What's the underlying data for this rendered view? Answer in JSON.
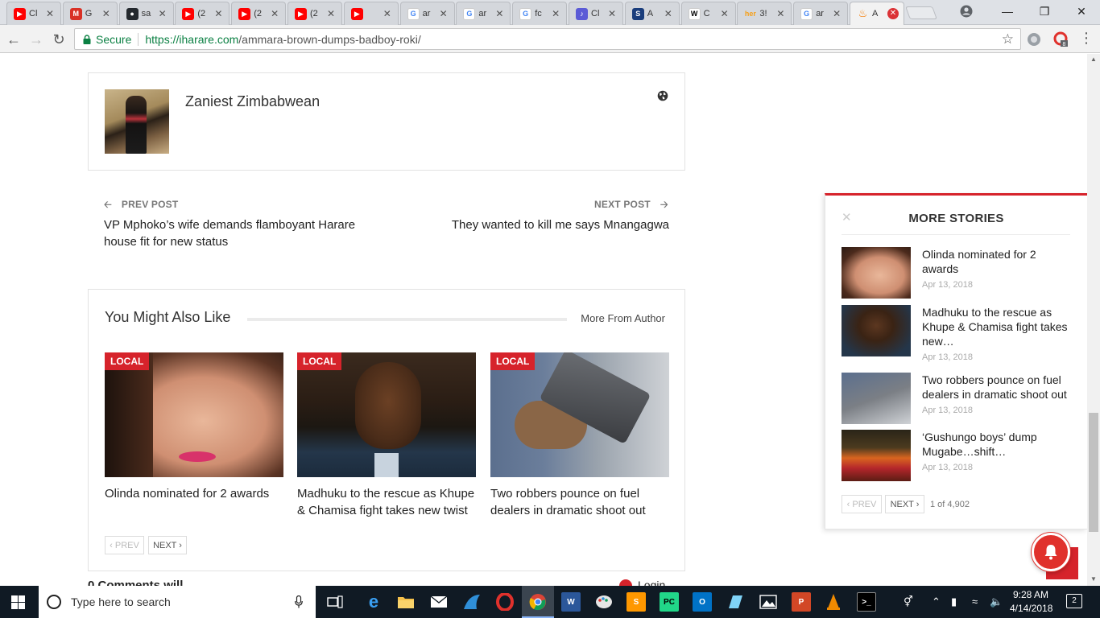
{
  "tabs": [
    {
      "label": "Cl",
      "favicon": "youtube-icon",
      "color": "#ff0000"
    },
    {
      "label": "G",
      "favicon": "gmail-icon",
      "color": "#d93025"
    },
    {
      "label": "sa",
      "favicon": "github-icon",
      "color": "#24292e"
    },
    {
      "label": "(2",
      "favicon": "youtube-icon",
      "color": "#ff0000"
    },
    {
      "label": "(2",
      "favicon": "youtube-icon",
      "color": "#ff0000"
    },
    {
      "label": "(2",
      "favicon": "youtube-icon",
      "color": "#ff0000"
    },
    {
      "label": "",
      "favicon": "youtube-audio-icon",
      "color": "#ff0000"
    },
    {
      "label": "ar",
      "favicon": "google-icon",
      "color": "#4285f4"
    },
    {
      "label": "ar",
      "favicon": "google-icon",
      "color": "#4285f4"
    },
    {
      "label": "fc",
      "favicon": "google-icon",
      "color": "#4285f4"
    },
    {
      "label": "Cl",
      "favicon": "guitar-icon",
      "color": "#5b5bd6"
    },
    {
      "label": "A",
      "favicon": "s-icon",
      "color": "#1a3d7c"
    },
    {
      "label": "C",
      "favicon": "wikipedia-icon",
      "color": "#ffffff"
    },
    {
      "label": "3!",
      "favicon": "her-icon",
      "color": "#f6a01a"
    },
    {
      "label": "ar",
      "favicon": "google-icon",
      "color": "#4285f4"
    },
    {
      "label": "A",
      "favicon": "fire-icon",
      "color": "#f57c00",
      "active": true
    }
  ],
  "toolbar": {
    "secure_label": "Secure",
    "url_scheme_host": "https://iharare.com",
    "url_path": "/ammara-brown-dumps-badboy-roki/",
    "ext_badge": "8"
  },
  "author": {
    "name": "Zaniest Zimbabwean"
  },
  "post_nav": {
    "prev_label": "PREV POST",
    "prev_title": "VP Mphoko’s wife demands flamboyant Harare house fit for new status",
    "next_label": "NEXT POST",
    "next_title": "They wanted to kill me says Mnangagwa"
  },
  "related": {
    "title": "You Might Also Like",
    "more_from_author": "More From Author",
    "cards": [
      {
        "badge": "LOCAL",
        "title": "Olinda nominated for 2 awards"
      },
      {
        "badge": "LOCAL",
        "title": "Madhuku to the rescue as Khupe & Chamisa fight takes new twist"
      },
      {
        "badge": "LOCAL",
        "title": "Two robbers pounce on fuel dealers in dramatic shoot out"
      }
    ],
    "prev_btn": "‹ PREV",
    "next_btn": "NEXT ›"
  },
  "more_stories": {
    "title": "MORE STORIES",
    "close": "✕",
    "items": [
      {
        "title": "Olinda nominated for 2 awards",
        "date": "Apr 13, 2018"
      },
      {
        "title": "Madhuku to the rescue as Khupe & Chamisa fight takes new…",
        "date": "Apr 13, 2018"
      },
      {
        "title": "Two robbers pounce on fuel dealers in dramatic shoot out",
        "date": "Apr 13, 2018"
      },
      {
        "title": "‘Gushungo boys’ dump Mugabe…shift…",
        "date": "Apr 13, 2018"
      }
    ],
    "prev_btn": "‹ PREV",
    "next_btn": "NEXT ›",
    "page_info": "1 of 4,902"
  },
  "comments": {
    "peek_text": "0 Comments will",
    "login_text": "Login"
  },
  "taskbar": {
    "search_placeholder": "Type here to search",
    "time": "9:28 AM",
    "date": "4/14/2018",
    "notifications": "2",
    "apps": [
      "task-view-icon",
      "edge-icon",
      "file-explorer-icon",
      "mail-icon",
      "wing-icon",
      "opera-icon",
      "chrome-icon",
      "word-icon",
      "paint-icon",
      "sublime-icon",
      "pycharm-icon",
      "outlook-icon",
      "app-icon",
      "photos-icon",
      "powerpoint-icon",
      "vlc-icon",
      "terminal-icon"
    ]
  },
  "colors": {
    "accent": "#d6232b",
    "secure_green": "#0b8043",
    "taskbar": "#101a24"
  }
}
